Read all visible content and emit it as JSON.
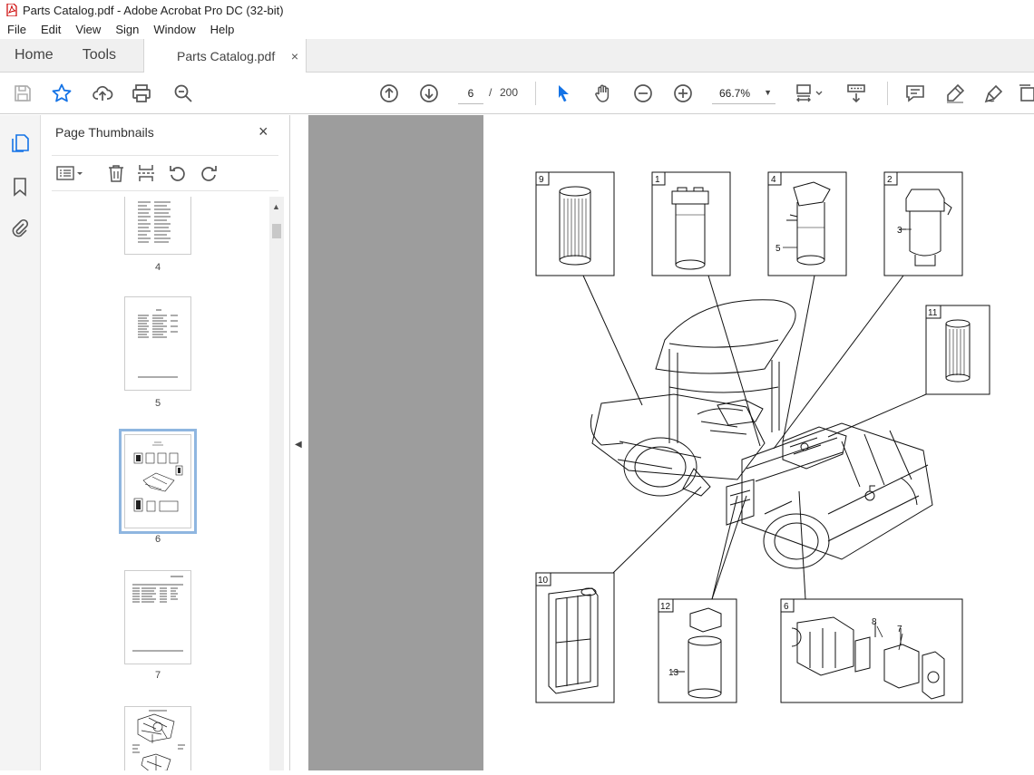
{
  "window": {
    "title": "Parts Catalog.pdf - Adobe Acrobat Pro DC (32-bit)"
  },
  "menu": [
    "File",
    "Edit",
    "View",
    "Sign",
    "Window",
    "Help"
  ],
  "tabs": {
    "home": "Home",
    "tools": "Tools",
    "document": "Parts Catalog.pdf",
    "close_glyph": "×"
  },
  "toolbar": {
    "current_page": "6",
    "separator": "/",
    "total_pages": "200",
    "zoom": "66.7%"
  },
  "panel": {
    "title": "Page Thumbnails",
    "close_glyph": "×"
  },
  "thumbnails": [
    {
      "label": "4"
    },
    {
      "label": "5"
    },
    {
      "label": "6",
      "selected": true
    },
    {
      "label": "7"
    }
  ],
  "callouts": {
    "box_labels": [
      "9",
      "1",
      "4",
      "2",
      "11",
      "10",
      "12",
      "6"
    ],
    "part_labels": [
      "5",
      "3",
      "8",
      "7",
      "13"
    ]
  },
  "colors": {
    "accent": "#1473e6",
    "viewer_bg": "#9d9d9d",
    "selected_thumb": "#8fb6e0"
  }
}
